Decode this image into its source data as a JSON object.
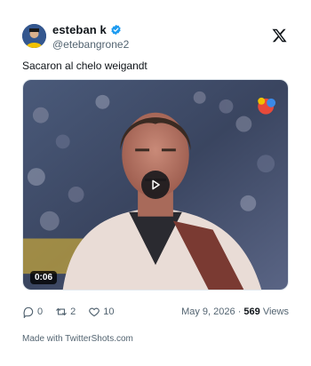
{
  "author": {
    "display_name": "esteban k",
    "handle": "@etebangrone2",
    "verified": true
  },
  "tweet": {
    "text": "Sacaron al chelo weigandt"
  },
  "media": {
    "type": "video",
    "duration": "0:06"
  },
  "engagement": {
    "replies": "0",
    "retweets": "2",
    "likes": "10"
  },
  "meta": {
    "date": "May 9, 2026",
    "separator": "·",
    "views_count": "569",
    "views_label": "Views"
  },
  "footer": {
    "text": "Made with TwitterShots.com"
  },
  "colors": {
    "text_primary": "#0f1419",
    "text_secondary": "#536471",
    "verified_blue": "#1d9bf0",
    "retweet_green": "#00ba7c"
  }
}
